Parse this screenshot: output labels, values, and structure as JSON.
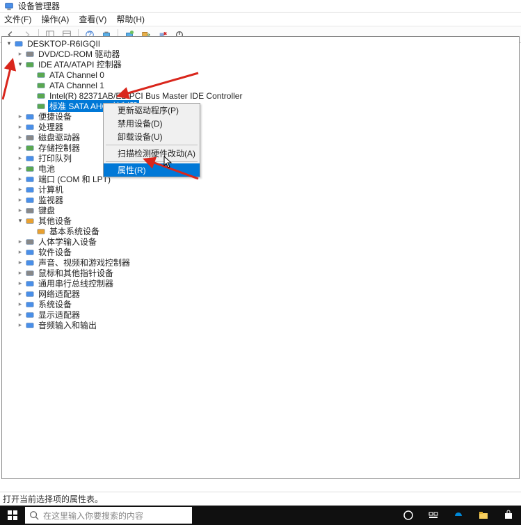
{
  "window": {
    "title": "设备管理器"
  },
  "menubar": {
    "file": "文件(F)",
    "action": "操作(A)",
    "view": "查看(V)",
    "help": "帮助(H)"
  },
  "tree": {
    "root": "DESKTOP-R6IGQII",
    "nodes": [
      {
        "label": "DVD/CD-ROM 驱动器",
        "expanded": false,
        "depth": 1,
        "icon": "cdrom"
      },
      {
        "label": "IDE ATA/ATAPI 控制器",
        "expanded": true,
        "depth": 1,
        "icon": "controller"
      },
      {
        "label": "ATA Channel 0",
        "expanded": null,
        "depth": 2,
        "icon": "controller"
      },
      {
        "label": "ATA Channel 1",
        "expanded": null,
        "depth": 2,
        "icon": "controller"
      },
      {
        "label": "Intel(R) 82371AB/EB PCI Bus Master IDE Controller",
        "expanded": null,
        "depth": 2,
        "icon": "controller"
      },
      {
        "label": "标准 SATA AHCI 控制器",
        "expanded": null,
        "depth": 2,
        "icon": "controller",
        "selected": true
      },
      {
        "label": "便捷设备",
        "expanded": false,
        "depth": 1,
        "icon": "portable"
      },
      {
        "label": "处理器",
        "expanded": false,
        "depth": 1,
        "icon": "cpu"
      },
      {
        "label": "磁盘驱动器",
        "expanded": false,
        "depth": 1,
        "icon": "disk"
      },
      {
        "label": "存储控制器",
        "expanded": false,
        "depth": 1,
        "icon": "storage"
      },
      {
        "label": "打印队列",
        "expanded": false,
        "depth": 1,
        "icon": "printer"
      },
      {
        "label": "电池",
        "expanded": false,
        "depth": 1,
        "icon": "battery"
      },
      {
        "label": "端口 (COM 和 LPT)",
        "expanded": false,
        "depth": 1,
        "icon": "port"
      },
      {
        "label": "计算机",
        "expanded": false,
        "depth": 1,
        "icon": "computer"
      },
      {
        "label": "监视器",
        "expanded": false,
        "depth": 1,
        "icon": "monitor"
      },
      {
        "label": "键盘",
        "expanded": false,
        "depth": 1,
        "icon": "keyboard"
      },
      {
        "label": "其他设备",
        "expanded": true,
        "depth": 1,
        "icon": "other"
      },
      {
        "label": "基本系统设备",
        "expanded": null,
        "depth": 2,
        "icon": "unknown"
      },
      {
        "label": "人体学输入设备",
        "expanded": false,
        "depth": 1,
        "icon": "hid"
      },
      {
        "label": "软件设备",
        "expanded": false,
        "depth": 1,
        "icon": "software"
      },
      {
        "label": "声音、视频和游戏控制器",
        "expanded": false,
        "depth": 1,
        "icon": "audio"
      },
      {
        "label": "鼠标和其他指针设备",
        "expanded": false,
        "depth": 1,
        "icon": "mouse"
      },
      {
        "label": "通用串行总线控制器",
        "expanded": false,
        "depth": 1,
        "icon": "usb"
      },
      {
        "label": "网络适配器",
        "expanded": false,
        "depth": 1,
        "icon": "network"
      },
      {
        "label": "系统设备",
        "expanded": false,
        "depth": 1,
        "icon": "system"
      },
      {
        "label": "显示适配器",
        "expanded": false,
        "depth": 1,
        "icon": "display"
      },
      {
        "label": "音频输入和输出",
        "expanded": false,
        "depth": 1,
        "icon": "audioio"
      }
    ]
  },
  "context_menu": {
    "items": [
      "更新驱动程序(P)",
      "禁用设备(D)",
      "卸载设备(U)",
      "扫描检测硬件改动(A)",
      "属性(R)"
    ],
    "highlighted_index": 4
  },
  "statusbar": {
    "text": "打开当前选择项的属性表。"
  },
  "taskbar": {
    "search_placeholder": "在这里输入你要搜索的内容"
  },
  "colors": {
    "selection": "#0078d7",
    "arrow_red": "#d9261c"
  }
}
